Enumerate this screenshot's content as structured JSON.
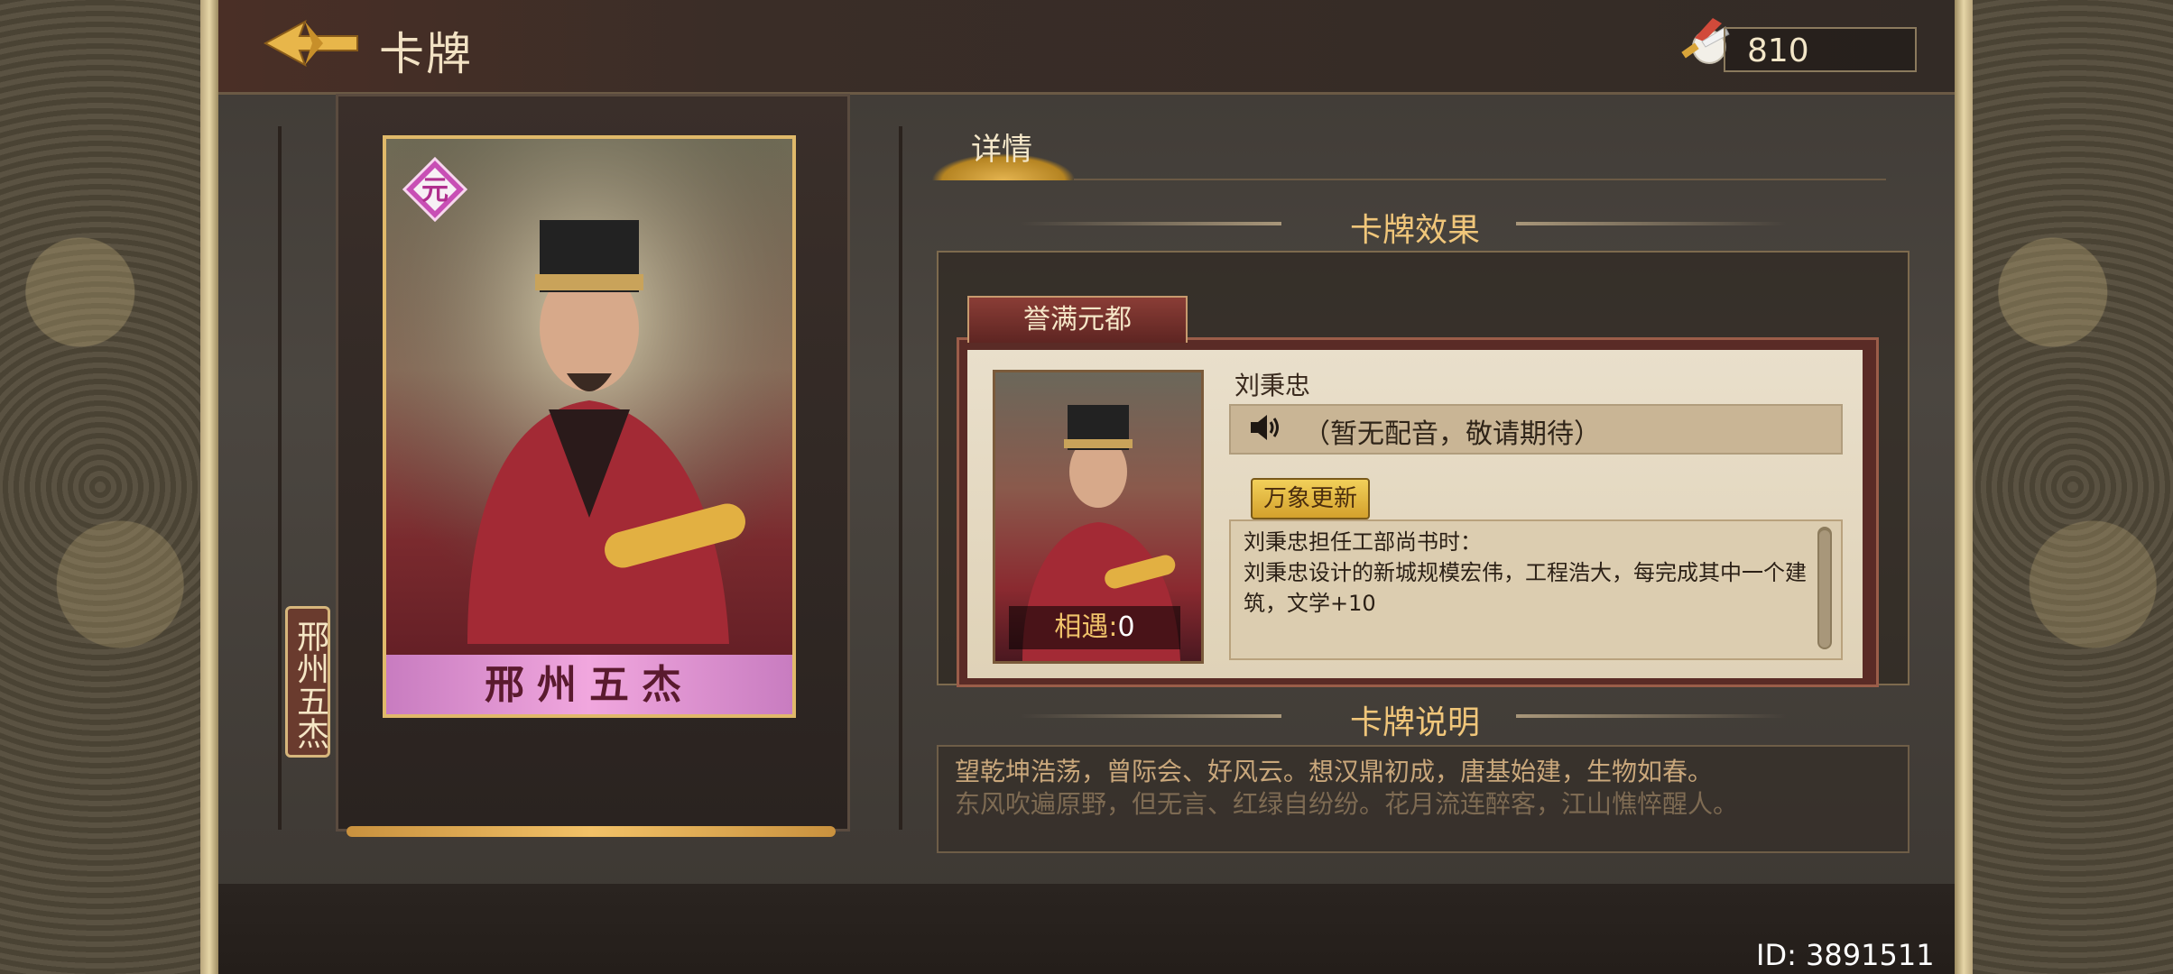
{
  "header": {
    "title": "卡牌",
    "currency_value": "810"
  },
  "card": {
    "badge": "元",
    "name_banner": "邢州五杰",
    "side_label": "邢州五杰"
  },
  "tabs": [
    {
      "label": "详情"
    }
  ],
  "effect": {
    "section_title": "卡牌效果",
    "skill_tab": "誉满元都",
    "character_name": "刘秉忠",
    "voice_text": "（暂无配音，敬请期待）",
    "update_button": "万象更新",
    "description_lines": [
      "刘秉忠担任工部尚书时：",
      "刘秉忠设计的新城规模宏伟，工程浩大，每完成其中一个建",
      "筑，文学+10"
    ],
    "encounter_label": "相遇:",
    "encounter_value": "0"
  },
  "story": {
    "section_title": "卡牌说明",
    "line1": "望乾坤浩荡，曾际会、好风云。想汉鼎初成，唐基始建，生物如春。",
    "line2": "东风吹遍原野，但无言、红绿自纷纷。花月流连醉客，江山憔悴醒人。"
  },
  "footer": {
    "id_text": "ID: 3891511"
  },
  "colors": {
    "accent_gold": "#f0c67a",
    "card_pink": "#f1a7de",
    "paper": "#e9dfcb"
  }
}
